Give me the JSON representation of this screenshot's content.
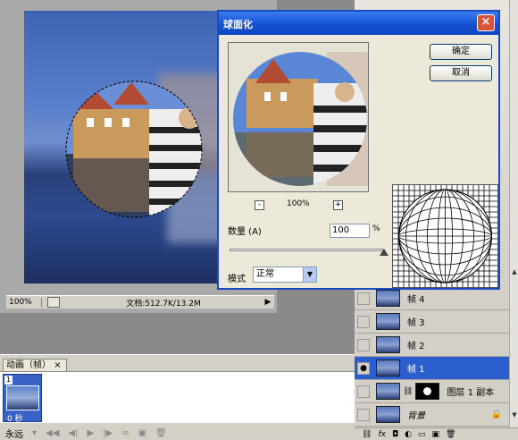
{
  "document": {
    "zoom": "100%",
    "info": "文档:512.7K/13.2M"
  },
  "dialog": {
    "title": "球面化",
    "ok_label": "确定",
    "cancel_label": "取消",
    "preview_zoom": "100%",
    "amount_label": "数量 (A)",
    "amount_value": "100",
    "amount_unit": "%",
    "mode_label": "模式",
    "mode_value": "正常"
  },
  "layers": [
    {
      "name": "帧 4",
      "visible": false,
      "selected": false
    },
    {
      "name": "帧 3",
      "visible": false,
      "selected": false
    },
    {
      "name": "帧 2",
      "visible": false,
      "selected": false
    },
    {
      "name": "帧 1",
      "visible": true,
      "selected": true
    },
    {
      "name": "图层 1 副本",
      "visible": false,
      "selected": false
    },
    {
      "name": "背景",
      "visible": false,
      "selected": false
    }
  ],
  "animation": {
    "tab_label": "动画（帧）",
    "frame_number": "1",
    "frame_delay": "0 秒",
    "loop_label": "永远"
  }
}
